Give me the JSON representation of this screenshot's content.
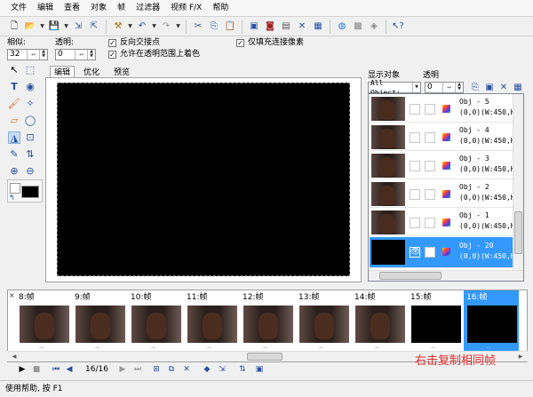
{
  "menu": [
    "文件",
    "编辑",
    "查看",
    "对象",
    "帧",
    "过滤器",
    "视频 F/X",
    "帮助"
  ],
  "options": {
    "similarity_label": "相似:",
    "similarity_value": "32",
    "opacity_label": "透明:",
    "opacity_value": "0",
    "reverse_antialias": "反向交接点",
    "allow_transparent": "允许在透明范围上着色",
    "fill_connected_only": "仅填充连接像素"
  },
  "tabs": [
    "编辑",
    "优化",
    "预览"
  ],
  "right_panel": {
    "display_objects_label": "显示对象",
    "opacity_label": "透明",
    "display_select": "All Object:",
    "opacity_value": "0"
  },
  "objects": [
    {
      "name": "Obj - 5",
      "info": "(0,0)(W:450,H:"
    },
    {
      "name": "Obj - 4",
      "info": "(0,0)(W:450,H:"
    },
    {
      "name": "Obj - 3",
      "info": "(0,0)(W:450,H:"
    },
    {
      "name": "Obj - 2",
      "info": "(0,0)(W:450,H:"
    },
    {
      "name": "Obj - 1",
      "info": "(0,0)(W:450,H:"
    },
    {
      "name": "Obj - 20",
      "info": "(0,0)(W:450,H:",
      "selected": true
    }
  ],
  "frames": [
    {
      "label": "8:帧"
    },
    {
      "label": "9:帧"
    },
    {
      "label": "10:帧"
    },
    {
      "label": "11:帧"
    },
    {
      "label": "12:帧"
    },
    {
      "label": "13:帧"
    },
    {
      "label": "14:帧"
    },
    {
      "label": "15:帧"
    },
    {
      "label": "16:帧",
      "selected": true
    }
  ],
  "playback": {
    "frame_counter": "16/16"
  },
  "status": "使用帮助, 按 F1",
  "annotation": "右击复制相同帧",
  "colors": {
    "selection": "#3399ff",
    "annotation": "#e03030"
  }
}
